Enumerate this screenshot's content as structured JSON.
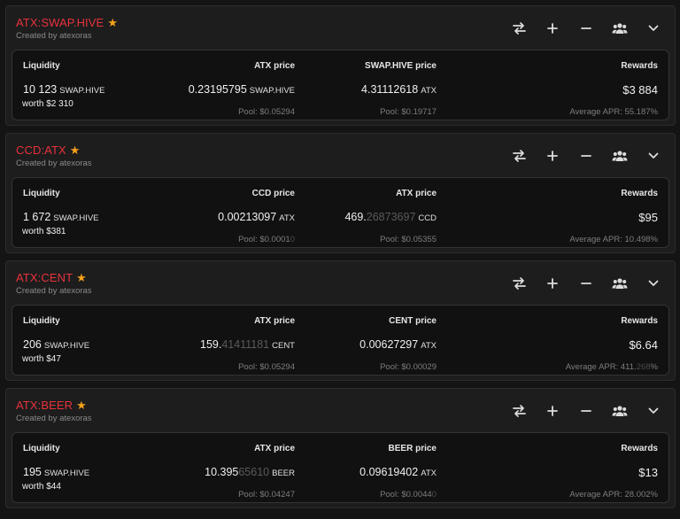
{
  "pools": [
    {
      "name": "ATX:SWAP.HIVE",
      "creator": "Created by atexoras",
      "labels": {
        "liquidity": "Liquidity",
        "price1": "ATX price",
        "price2": "SWAP.HIVE price",
        "rewards": "Rewards"
      },
      "liquidity_amount": "10 123",
      "liquidity_unit": "SWAP.HIVE",
      "worth": "worth $2 310",
      "price1_main": "0.23195795",
      "price1_faint": "",
      "price1_unit": "SWAP.HIVE",
      "pool1_main": "Pool: $0.05294",
      "pool1_faint": "",
      "price2_main": "4.31112618",
      "price2_faint": "",
      "price2_unit": "ATX",
      "pool2_main": "Pool: $0.19717",
      "pool2_faint": "",
      "rewards_value": "$3 884",
      "apr_main": "Average APR: 55.187%",
      "apr_faint": "",
      "apr_tail": ""
    },
    {
      "name": "CCD:ATX",
      "creator": "Created by atexoras",
      "labels": {
        "liquidity": "Liquidity",
        "price1": "CCD price",
        "price2": "ATX price",
        "rewards": "Rewards"
      },
      "liquidity_amount": "1 672",
      "liquidity_unit": "SWAP.HIVE",
      "worth": "worth $381",
      "price1_main": "0.00213097",
      "price1_faint": "",
      "price1_unit": "ATX",
      "pool1_main": "Pool: $0.0001",
      "pool1_faint": "0",
      "price2_main": "469.",
      "price2_faint": "26873697",
      "price2_unit": "CCD",
      "pool2_main": "Pool: $0.05355",
      "pool2_faint": "",
      "rewards_value": "$95",
      "apr_main": "Average APR: 10.498%",
      "apr_faint": "",
      "apr_tail": ""
    },
    {
      "name": "ATX:CENT",
      "creator": "Created by atexoras",
      "labels": {
        "liquidity": "Liquidity",
        "price1": "ATX price",
        "price2": "CENT price",
        "rewards": "Rewards"
      },
      "liquidity_amount": "206",
      "liquidity_unit": "SWAP.HIVE",
      "worth": "worth $47",
      "price1_main": "159.",
      "price1_faint": "41411181",
      "price1_unit": "CENT",
      "pool1_main": "Pool: $0.05294",
      "pool1_faint": "",
      "price2_main": "0.00627297",
      "price2_faint": "",
      "price2_unit": "ATX",
      "pool2_main": "Pool: $0.00029",
      "pool2_faint": "",
      "rewards_value": "$6.64",
      "apr_main": "Average APR: 411.",
      "apr_faint": "268",
      "apr_tail": "%"
    },
    {
      "name": "ATX:BEER",
      "creator": "Created by atexoras",
      "labels": {
        "liquidity": "Liquidity",
        "price1": "ATX price",
        "price2": "BEER price",
        "rewards": "Rewards"
      },
      "liquidity_amount": "195",
      "liquidity_unit": "SWAP.HIVE",
      "worth": "worth $44",
      "price1_main": "10.395",
      "price1_faint": "65610",
      "price1_unit": "BEER",
      "pool1_main": "Pool: $0.04247",
      "pool1_faint": "",
      "price2_main": "0.09619402",
      "price2_faint": "",
      "price2_unit": "ATX",
      "pool2_main": "Pool: $0.0044",
      "pool2_faint": "0",
      "rewards_value": "$13",
      "apr_main": "Average APR: 28.002%",
      "apr_faint": "",
      "apr_tail": ""
    }
  ],
  "icons": [
    "swap-icon",
    "plus-icon",
    "minus-icon",
    "users-icon",
    "chevron-down-icon"
  ],
  "colors": {
    "pool_name": "#e8323c",
    "star": "#f5a11a",
    "background": "#141414",
    "card": "#1d1d1d"
  }
}
